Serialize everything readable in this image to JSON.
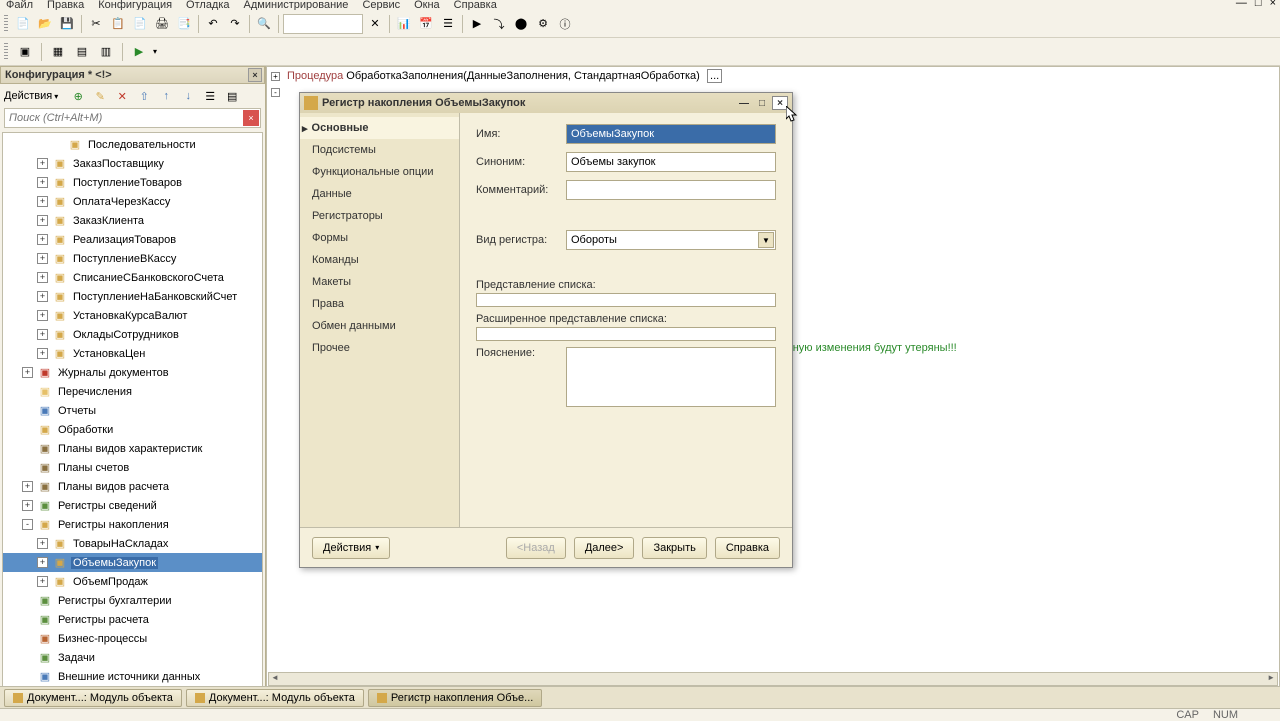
{
  "menubar": [
    "Файл",
    "Правка",
    "Конфигурация",
    "Отладка",
    "Администрирование",
    "Сервис",
    "Окна",
    "Справка"
  ],
  "sidebar": {
    "title": "Конфигурация * <!>",
    "actions_label": "Действия",
    "search_placeholder": "Поиск (Ctrl+Alt+M)",
    "tree": [
      {
        "indent": 3,
        "toggle": "",
        "ico": "ic-doc",
        "label": "Последовательности"
      },
      {
        "indent": 2,
        "toggle": "+",
        "ico": "ic-doc",
        "label": "ЗаказПоставщику"
      },
      {
        "indent": 2,
        "toggle": "+",
        "ico": "ic-doc",
        "label": "ПоступлениеТоваров"
      },
      {
        "indent": 2,
        "toggle": "+",
        "ico": "ic-doc",
        "label": "ОплатаЧерезКассу"
      },
      {
        "indent": 2,
        "toggle": "+",
        "ico": "ic-doc",
        "label": "ЗаказКлиента"
      },
      {
        "indent": 2,
        "toggle": "+",
        "ico": "ic-doc",
        "label": "РеализацияТоваров"
      },
      {
        "indent": 2,
        "toggle": "+",
        "ico": "ic-doc",
        "label": "ПоступлениеВКассу"
      },
      {
        "indent": 2,
        "toggle": "+",
        "ico": "ic-doc",
        "label": "СписаниеСБанковскогоСчета"
      },
      {
        "indent": 2,
        "toggle": "+",
        "ico": "ic-doc",
        "label": "ПоступлениеНаБанковскийСчет"
      },
      {
        "indent": 2,
        "toggle": "+",
        "ico": "ic-doc",
        "label": "УстановкаКурсаВалют"
      },
      {
        "indent": 2,
        "toggle": "+",
        "ico": "ic-doc",
        "label": "ОкладыСотрудников"
      },
      {
        "indent": 2,
        "toggle": "+",
        "ico": "ic-doc",
        "label": "УстановкаЦен"
      },
      {
        "indent": 1,
        "toggle": "+",
        "ico": "ic-book",
        "label": "Журналы документов"
      },
      {
        "indent": 1,
        "toggle": "",
        "ico": "ic-fold",
        "label": "Перечисления"
      },
      {
        "indent": 1,
        "toggle": "",
        "ico": "ic-rep",
        "label": "Отчеты"
      },
      {
        "indent": 1,
        "toggle": "",
        "ico": "ic-proc",
        "label": "Обработки"
      },
      {
        "indent": 1,
        "toggle": "",
        "ico": "ic-plan",
        "label": "Планы видов характеристик"
      },
      {
        "indent": 1,
        "toggle": "",
        "ico": "ic-plan",
        "label": "Планы счетов"
      },
      {
        "indent": 1,
        "toggle": "+",
        "ico": "ic-plan",
        "label": "Планы видов расчета"
      },
      {
        "indent": 1,
        "toggle": "+",
        "ico": "ic-reg",
        "label": "Регистры сведений"
      },
      {
        "indent": 1,
        "toggle": "-",
        "ico": "ic-cube",
        "label": "Регистры накопления"
      },
      {
        "indent": 2,
        "toggle": "+",
        "ico": "ic-cube",
        "label": "ТоварыНаСкладах"
      },
      {
        "indent": 2,
        "toggle": "+",
        "ico": "ic-cube",
        "label": "ОбъемыЗакупок",
        "sel": true
      },
      {
        "indent": 2,
        "toggle": "+",
        "ico": "ic-cube",
        "label": "ОбъемПродаж"
      },
      {
        "indent": 1,
        "toggle": "",
        "ico": "ic-reg",
        "label": "Регистры бухгалтерии"
      },
      {
        "indent": 1,
        "toggle": "",
        "ico": "ic-reg",
        "label": "Регистры расчета"
      },
      {
        "indent": 1,
        "toggle": "",
        "ico": "ic-biz",
        "label": "Бизнес-процессы"
      },
      {
        "indent": 1,
        "toggle": "",
        "ico": "ic-task",
        "label": "Задачи"
      },
      {
        "indent": 1,
        "toggle": "",
        "ico": "ic-ext",
        "label": "Внешние источники данных"
      }
    ]
  },
  "code": {
    "line1_kw": "Процедура",
    "line1_rest": " ОбработкаЗаполнения(ДанныеЗаполнения, СтандартнаяОбработка)",
    "line2": "чную изменения будут утеряны!!!"
  },
  "dialog": {
    "title": "Регистр накопления ОбъемыЗакупок",
    "nav": [
      "Основные",
      "Подсистемы",
      "Функциональные опции",
      "Данные",
      "Регистраторы",
      "Формы",
      "Команды",
      "Макеты",
      "Права",
      "Обмен данными",
      "Прочее"
    ],
    "labels": {
      "name": "Имя:",
      "synonym": "Синоним:",
      "comment": "Комментарий:",
      "regtype": "Вид регистра:",
      "listpres": "Представление списка:",
      "extlistpres": "Расширенное представление списка:",
      "explain": "Пояснение:"
    },
    "values": {
      "name": "ОбъемыЗакупок",
      "synonym": "Объемы закупок",
      "comment": "",
      "regtype": "Обороты",
      "listpres": "",
      "extlistpres": "",
      "explain": ""
    },
    "buttons": {
      "actions": "Действия",
      "back": "<Назад",
      "next": "Далее>",
      "close": "Закрыть",
      "help": "Справка"
    }
  },
  "taskbar": [
    {
      "label": "Документ...: Модуль объекта"
    },
    {
      "label": "Документ...: Модуль объекта"
    },
    {
      "label": "Регистр накопления Объе...",
      "active": true
    }
  ],
  "status": {
    "cap": "CAP",
    "num": "NUM"
  }
}
